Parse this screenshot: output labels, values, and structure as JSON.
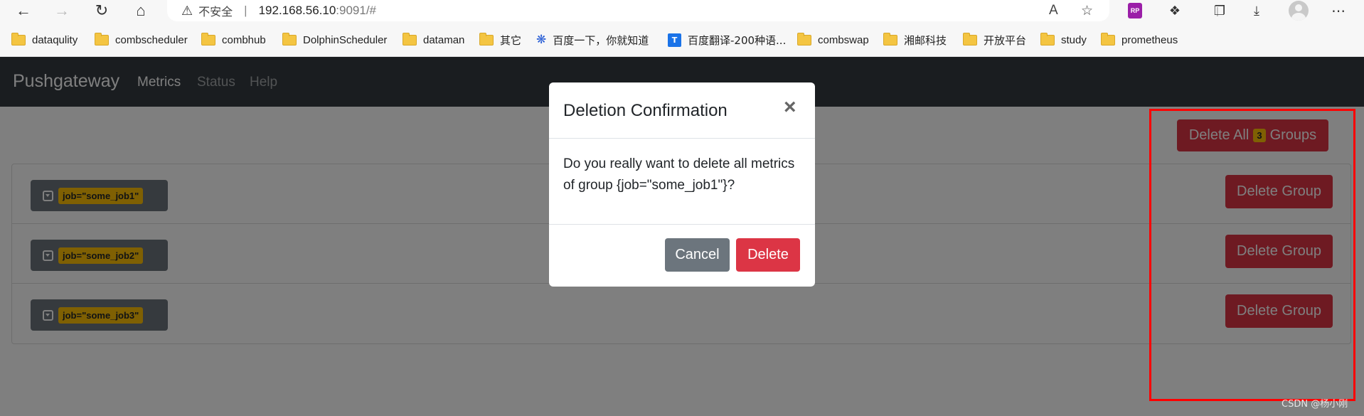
{
  "browser": {
    "url_warning": "不安全",
    "url_host": "192.168.56.10",
    "url_rest": ":9091/#",
    "bookmarks": [
      {
        "label": "dataqulity",
        "icon": "folder-icon"
      },
      {
        "label": "combscheduler",
        "icon": "folder-icon"
      },
      {
        "label": "combhub",
        "icon": "folder-icon"
      },
      {
        "label": "DolphinScheduler",
        "icon": "folder-icon"
      },
      {
        "label": "dataman",
        "icon": "folder-icon"
      },
      {
        "label": "其它",
        "icon": "folder-icon"
      },
      {
        "label": "百度一下，你就知道",
        "icon": "baidu-paw-icon"
      },
      {
        "label": "百度翻译-200种语...",
        "icon": "baidu-translate-icon"
      },
      {
        "label": "combswap",
        "icon": "folder-icon"
      },
      {
        "label": "湘邮科技",
        "icon": "folder-icon"
      },
      {
        "label": "开放平台",
        "icon": "folder-icon"
      },
      {
        "label": "study",
        "icon": "folder-icon"
      },
      {
        "label": "prometheus",
        "icon": "folder-icon"
      }
    ],
    "ext_rp_label": "RP"
  },
  "navbar": {
    "brand": "Pushgateway",
    "links": [
      "Metrics",
      "Status",
      "Help"
    ]
  },
  "main": {
    "delete_all": {
      "prefix": "Delete All",
      "count": "3",
      "suffix": "Groups"
    },
    "groups": [
      {
        "label": "job=\"some_job1\"",
        "action": "Delete Group"
      },
      {
        "label": "job=\"some_job2\"",
        "action": "Delete Group"
      },
      {
        "label": "job=\"some_job3\"",
        "action": "Delete Group"
      }
    ]
  },
  "modal": {
    "title": "Deletion Confirmation",
    "close": "×",
    "body": "Do you really want to delete all metrics of group {job=\"some_job1\"}?",
    "cancel": "Cancel",
    "delete": "Delete"
  },
  "watermark": "CSDN @杨小刚",
  "colors": {
    "navbar": "#343a40",
    "danger": "#dc3545",
    "secondary": "#6c757d",
    "warning_badge": "#ffc107",
    "annotation": "#ff0000"
  }
}
